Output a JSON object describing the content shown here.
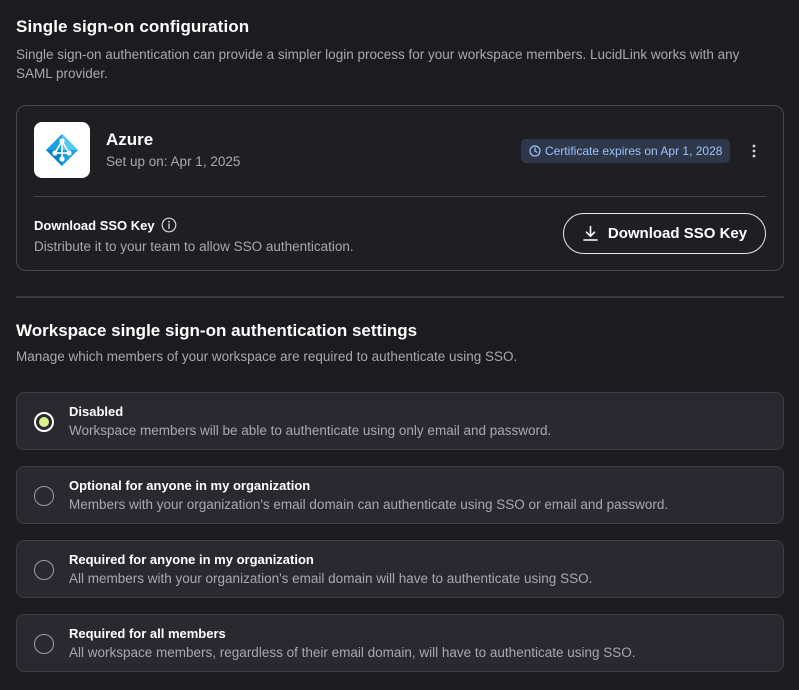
{
  "sso": {
    "title": "Single sign-on configuration",
    "description": "Single sign-on authentication can provide a simpler login process for your workspace members. LucidLink works with any SAML provider."
  },
  "provider": {
    "name": "Azure",
    "setup_date": "Set up on: Apr 1, 2025",
    "certificate_badge": "Certificate expires on Apr 1, 2028",
    "logo_icon": "azure-ad-icon",
    "logo_color": "#1ba1e2"
  },
  "download": {
    "title": "Download SSO Key",
    "description": "Distribute it to your team to allow SSO authentication.",
    "button_label": "Download SSO Key"
  },
  "settings": {
    "title": "Workspace single sign-on authentication settings",
    "description": "Manage which members of your workspace are required to authenticate using SSO.",
    "options": [
      {
        "title": "Disabled",
        "description": "Workspace members will be able to authenticate using only email and password.",
        "selected": true
      },
      {
        "title": "Optional for anyone in my organization",
        "description": "Members with your organization's email domain can authenticate using SSO or email and password.",
        "selected": false
      },
      {
        "title": "Required for anyone in my organization",
        "description": "All members with your organization's email domain will have to authenticate using SSO.",
        "selected": false
      },
      {
        "title": "Required for all members",
        "description": "All workspace members, regardless of their email domain, will have to authenticate using SSO.",
        "selected": false
      }
    ]
  },
  "colors": {
    "background": "#1c1b20",
    "accent_radio": "#d6f28a",
    "badge_text": "#9cc3ff"
  }
}
